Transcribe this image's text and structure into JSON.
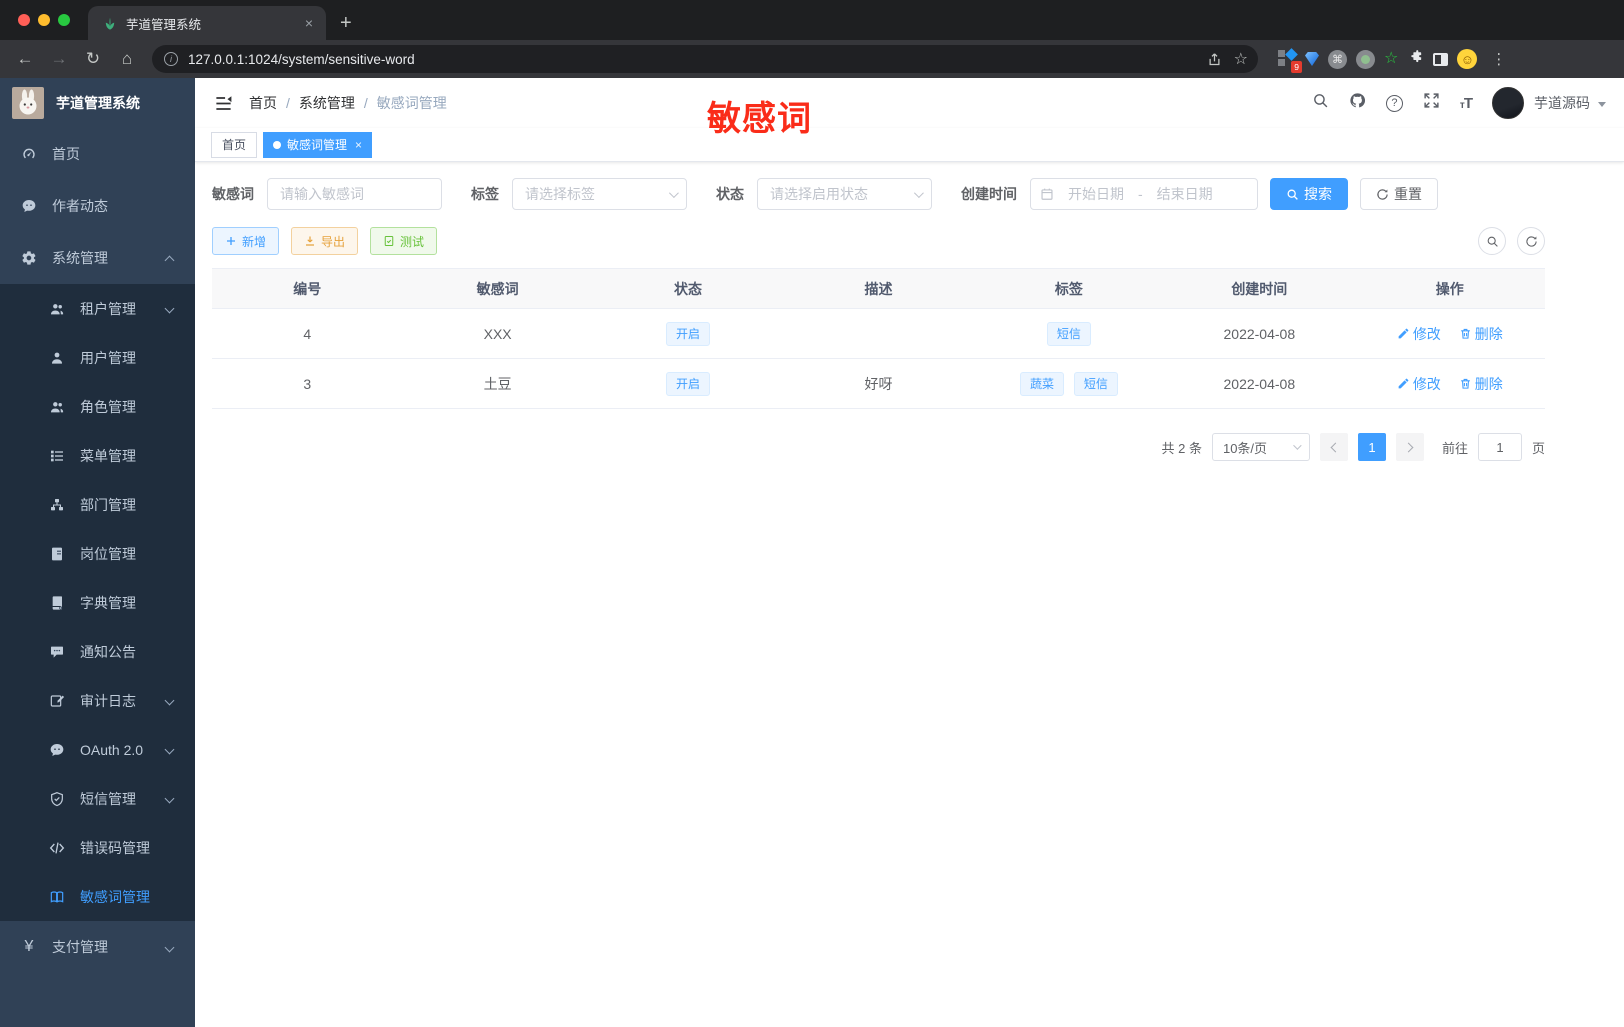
{
  "browser": {
    "tab_title": "芋道管理系统",
    "url": "127.0.0.1:1024/system/sensitive-word",
    "extension_badge": "9",
    "new_tab": "+",
    "close_tab": "×"
  },
  "sidebar": {
    "title": "芋道管理系统",
    "items": [
      {
        "label": "首页"
      },
      {
        "label": "作者动态"
      },
      {
        "label": "系统管理"
      },
      {
        "label": "租户管理"
      },
      {
        "label": "用户管理"
      },
      {
        "label": "角色管理"
      },
      {
        "label": "菜单管理"
      },
      {
        "label": "部门管理"
      },
      {
        "label": "岗位管理"
      },
      {
        "label": "字典管理"
      },
      {
        "label": "通知公告"
      },
      {
        "label": "审计日志"
      },
      {
        "label": "OAuth 2.0"
      },
      {
        "label": "短信管理"
      },
      {
        "label": "错误码管理"
      },
      {
        "label": "敏感词管理"
      },
      {
        "label": "支付管理"
      }
    ]
  },
  "header": {
    "breadcrumb": [
      "首页",
      "系统管理",
      "敏感词管理"
    ],
    "user_name": "芋道源码"
  },
  "annotation": {
    "label": "敏感词",
    "color": "#fa2c19"
  },
  "tags_view": {
    "home": "首页",
    "active": "敏感词管理"
  },
  "filters": {
    "keyword_label": "敏感词",
    "keyword_placeholder": "请输入敏感词",
    "tag_label": "标签",
    "tag_placeholder": "请选择标签",
    "status_label": "状态",
    "status_placeholder": "请选择启用状态",
    "date_label": "创建时间",
    "date_start_placeholder": "开始日期",
    "date_separator": "-",
    "date_end_placeholder": "结束日期",
    "search_label": "搜索",
    "reset_label": "重置"
  },
  "toolbar": {
    "add_label": "新增",
    "export_label": "导出",
    "test_label": "测试"
  },
  "table": {
    "columns": [
      "编号",
      "敏感词",
      "状态",
      "描述",
      "标签",
      "创建时间",
      "操作"
    ],
    "rows": [
      {
        "id": "4",
        "word": "XXX",
        "status": "开启",
        "description": "",
        "tags": [
          "短信"
        ],
        "created": "2022-04-08",
        "edit": "修改",
        "delete": "删除"
      },
      {
        "id": "3",
        "word": "土豆",
        "status": "开启",
        "description": "好呀",
        "tags": [
          "蔬菜",
          "短信"
        ],
        "created": "2022-04-08",
        "edit": "修改",
        "delete": "删除"
      }
    ]
  },
  "pagination": {
    "total": "共 2 条",
    "page_size": "10条/页",
    "current_page": "1",
    "goto_label": "前往",
    "goto_value": "1",
    "page_unit": "页"
  },
  "colors": {
    "accent": "#409eff",
    "annotation_red": "#fa2c19",
    "success": "#67c23a",
    "warning": "#e6a23c",
    "sidebar_bg": "#304156",
    "submenu_bg": "#1f2d3d",
    "tag_bg": "#ecf5ff"
  }
}
